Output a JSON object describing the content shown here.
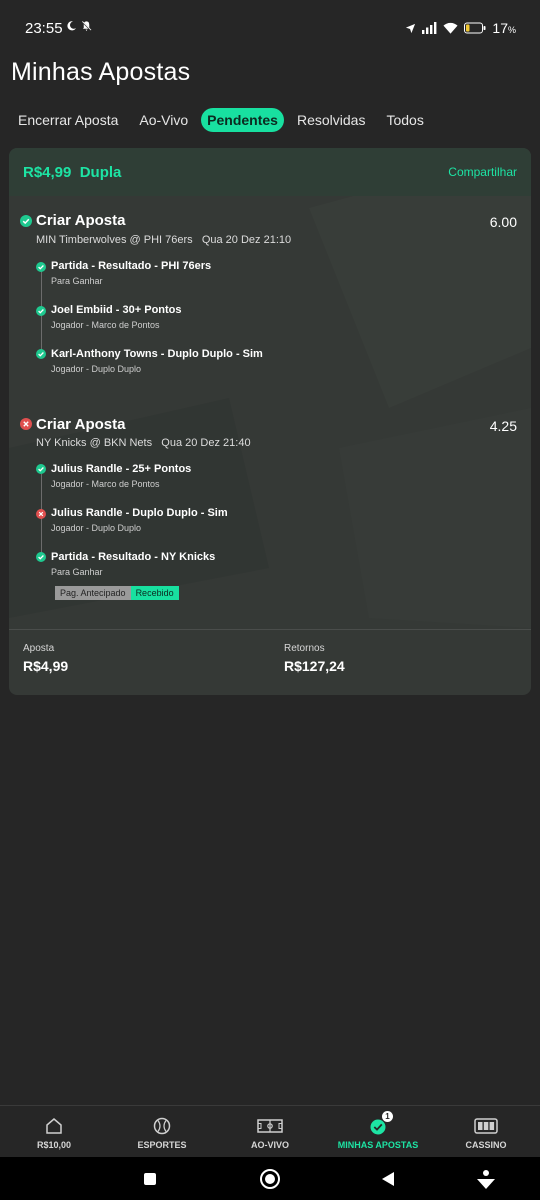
{
  "status_bar": {
    "time": "23:55",
    "battery": "17"
  },
  "page": {
    "title": "Minhas Apostas"
  },
  "tabs": [
    {
      "label": "Encerrar Aposta",
      "active": false
    },
    {
      "label": "Ao-Vivo",
      "active": false
    },
    {
      "label": "Pendentes",
      "active": true
    },
    {
      "label": "Resolvidas",
      "active": false
    },
    {
      "label": "Todos",
      "active": false
    }
  ],
  "bet": {
    "header": {
      "stake_and_type": "R$4,99  Dupla",
      "share_label": "Compartilhar"
    },
    "groups": [
      {
        "title": "Criar Aposta",
        "status": "won",
        "odds": "6.00",
        "event": "MIN Timberwolves @ PHI 76ers",
        "datetime": "Qua 20 Dez 21:10",
        "selections": [
          {
            "title": "Partida - Resultado - PHI 76ers",
            "sub": "Para Ganhar",
            "status": "won"
          },
          {
            "title": "Joel Embiid - 30+ Pontos",
            "sub": "Jogador - Marco de Pontos",
            "status": "won"
          },
          {
            "title": "Karl-Anthony Towns - Duplo Duplo - Sim",
            "sub": "Jogador - Duplo Duplo",
            "status": "won"
          }
        ]
      },
      {
        "title": "Criar Aposta",
        "status": "lost",
        "odds": "4.25",
        "event": "NY Knicks @ BKN Nets",
        "datetime": "Qua 20 Dez 21:40",
        "selections": [
          {
            "title": "Julius Randle - 25+ Pontos",
            "sub": "Jogador - Marco de Pontos",
            "status": "won"
          },
          {
            "title": "Julius Randle - Duplo Duplo - Sim",
            "sub": "Jogador - Duplo Duplo",
            "status": "lost"
          },
          {
            "title": "Partida - Resultado - NY Knicks",
            "sub": "Para Ganhar",
            "status": "won"
          }
        ],
        "badges": {
          "early_payout": "Pag. Antecipado",
          "received": "Recebido"
        }
      }
    ],
    "summary": {
      "stake_label": "Aposta",
      "stake_value": "R$4,99",
      "returns_label": "Retornos",
      "returns_value": "R$127,24"
    }
  },
  "bottom_nav": [
    {
      "label": "R$10,00",
      "icon": "home-icon"
    },
    {
      "label": "ESPORTES",
      "icon": "ball-icon"
    },
    {
      "label": "AO-VIVO",
      "icon": "field-icon"
    },
    {
      "label": "MINHAS APOSTAS",
      "icon": "check-badge-icon",
      "badge": "1",
      "active": true
    },
    {
      "label": "CASSINO",
      "icon": "slot-icon"
    }
  ],
  "colors": {
    "accent": "#1de4a4",
    "won": "#1ec98f",
    "lost": "#e0504f",
    "background": "#262626",
    "card": "#353936"
  }
}
